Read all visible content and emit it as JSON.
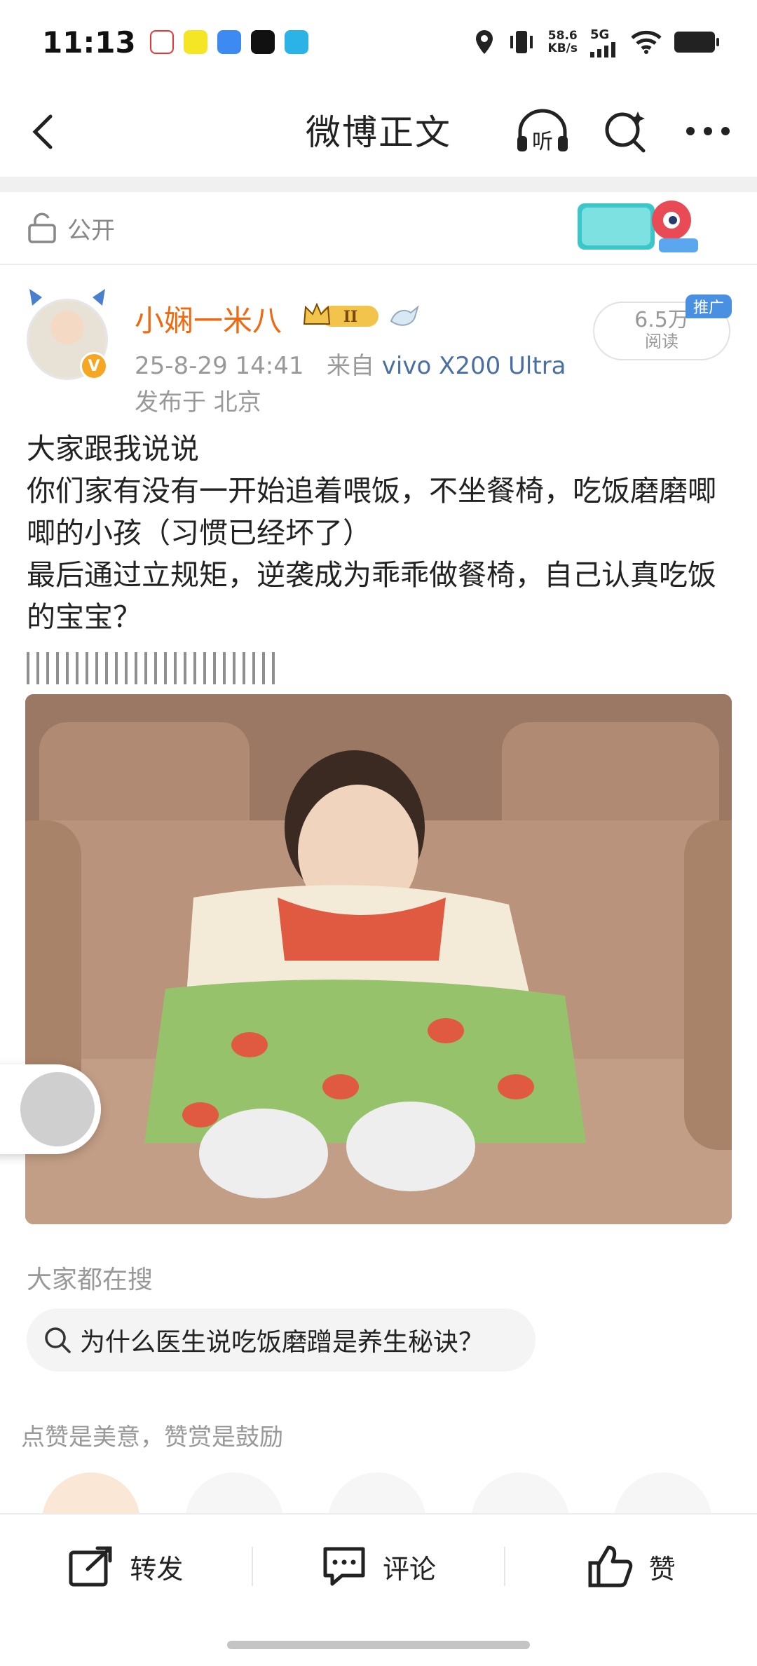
{
  "status_bar": {
    "time": "11:13",
    "net_speed_value": "58.6",
    "net_speed_unit": "KB/s",
    "network_type": "5G"
  },
  "header": {
    "title": "微博正文",
    "listen_label": "听"
  },
  "visibility": {
    "label": "公开"
  },
  "post": {
    "author": "小娴一米八",
    "vip_level": "II",
    "date": "25-8-29 14:41",
    "source_prefix": "来自",
    "device": "vivo X200 Ultra",
    "location": "发布于 北京",
    "read_count": "6.5万",
    "read_label": "阅读",
    "promo_tag": "推广",
    "text": "大家跟我说说\n你们家有没有一开始追着喂饭，不坐餐椅，吃饭磨磨唧唧的小孩（习惯已经坏了）\n最后通过立规矩，逆袭成为乖乖做餐椅，自己认真吃饭的宝宝？"
  },
  "search_suggest": {
    "heading": "大家都在搜",
    "query": "为什么医生说吃饭磨蹭是养生秘诀？"
  },
  "reward": {
    "tip": "点赞是美意，赞赏是鼓励"
  },
  "bottom_bar": {
    "repost": "转发",
    "comment": "评论",
    "like": "赞"
  },
  "colors": {
    "username": "#f0690f",
    "device_link": "#4a6fa5",
    "promo": "#4a90e2"
  }
}
